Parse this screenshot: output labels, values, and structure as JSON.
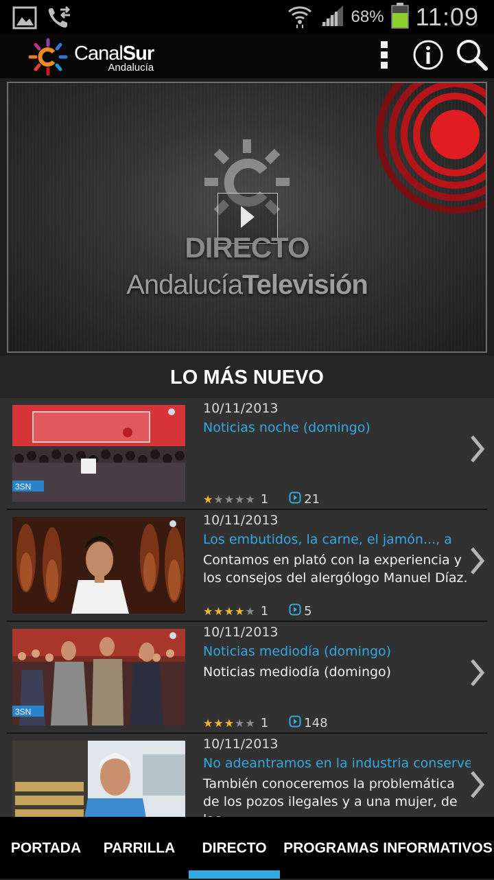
{
  "status_bar": {
    "battery_percent": "68%",
    "time": "11:09",
    "icons": [
      "image-notification-icon",
      "call-forward-icon",
      "wifi-icon",
      "signal-icon",
      "battery-icon"
    ]
  },
  "app_bar": {
    "brand_light": "Canal",
    "brand_bold": "Sur",
    "brand_sub": "Andalucía",
    "actions": [
      "overflow-menu-icon",
      "info-icon",
      "search-icon"
    ]
  },
  "player": {
    "line1": "DIRECTO",
    "line2_light": "Andalucía",
    "line2_bold": "Televisión"
  },
  "section": {
    "title": "LO MÁS NUEVO"
  },
  "items": [
    {
      "date": "10/11/2013",
      "title": "Noticias noche (domingo)",
      "desc": "",
      "rating": 1,
      "rating_count": "1",
      "views": "21"
    },
    {
      "date": "10/11/2013",
      "title": "Los embutidos, la carne, el jamón..., a",
      "desc": "Contamos en plató con la experiencia y los consejos del alergólogo Manuel Díaz.",
      "rating": 4,
      "rating_count": "1",
      "views": "5"
    },
    {
      "date": "10/11/2013",
      "title": "Noticias mediodía (domingo)",
      "desc": "Noticias mediodía (domingo)",
      "rating": 3,
      "rating_count": "1",
      "views": "148"
    },
    {
      "date": "10/11/2013",
      "title": "No adeantramos en la industria conservera",
      "desc": "También conoceremos la problemática de los pozos ilegales y a una mujer, de las",
      "rating": 0,
      "rating_count": "",
      "views": ""
    }
  ],
  "bottom_nav": {
    "tabs": [
      "PORTADA",
      "PARRILLA",
      "DIRECTO",
      "PROGRAMAS",
      "INFORMATIVOS"
    ],
    "active": "DIRECTO"
  },
  "colors": {
    "accent": "#33a9e0",
    "star": "#f0b62c",
    "live_red": "#d0171b"
  }
}
